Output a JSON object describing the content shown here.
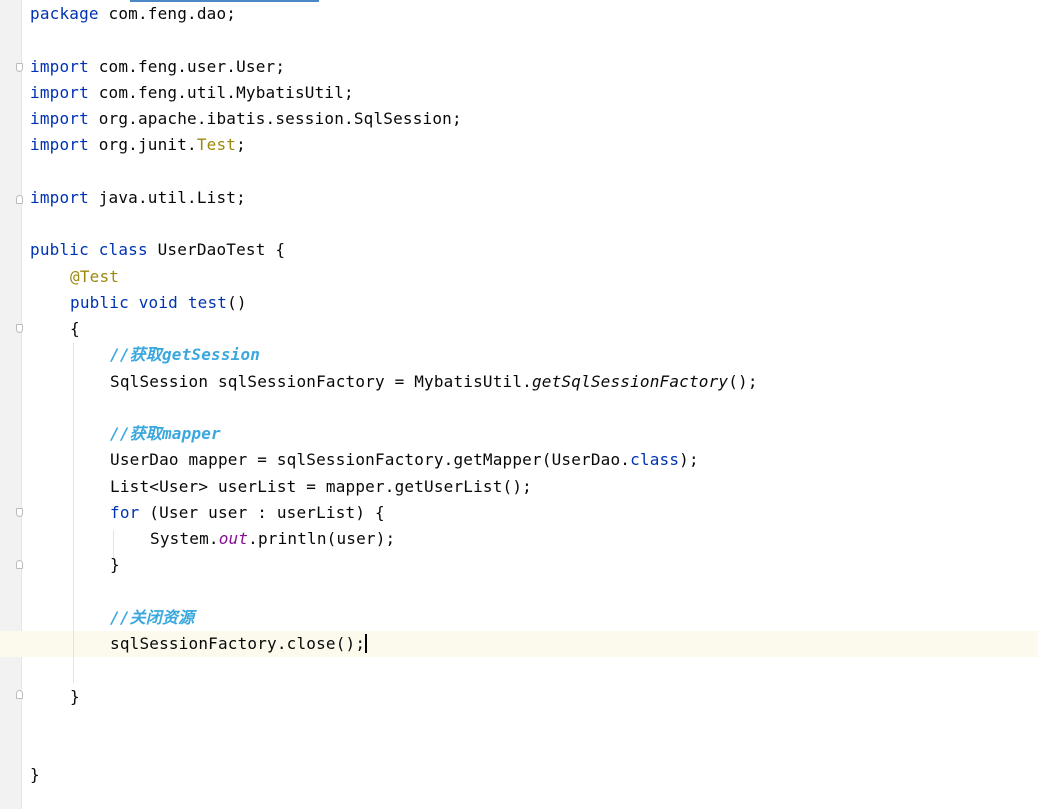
{
  "editor": {
    "code": {
      "package_kw": "package",
      "package_name": " com.feng.dao;",
      "import_kw": "import",
      "import_1": " com.feng.user.User;",
      "import_2": " com.feng.util.MybatisUtil;",
      "import_3": " org.apache.ibatis.session.SqlSession;",
      "import_4_pre": " org.junit.",
      "import_4_test": "Test",
      "import_4_post": ";",
      "import_5": " java.util.List;",
      "public_kw": "public",
      "class_kw": "class",
      "class_name": " UserDaoTest {",
      "annotation": "@Test",
      "void_kw": "void",
      "method_name": "test",
      "method_parens": "()",
      "open_brace": "{",
      "comment_1": "//获取getSession",
      "line_session_pre": "SqlSession sqlSessionFactory = MybatisUtil.",
      "line_session_call": "getSqlSessionFactory",
      "line_session_post": "();",
      "comment_2": "//获取mapper",
      "line_mapper_pre": "UserDao mapper = sqlSessionFactory.getMapper(UserDao.",
      "line_mapper_class": "class",
      "line_mapper_post": ");",
      "line_list": "List<User> userList = mapper.getUserList();",
      "for_kw": "for",
      "for_rest": " (User user : userList) {",
      "print_pre": "System.",
      "print_out": "out",
      "print_post": ".println(user);",
      "close_brace": "}",
      "comment_3": "//关闭资源",
      "line_close": "sqlSessionFactory.close();"
    }
  },
  "colors": {
    "keyword": "#0033b3",
    "annotation": "#9e880d",
    "comment": "#3aa8de",
    "static_field": "#871094",
    "caret_line": "#fcfaed",
    "gutter": "#f2f2f2"
  }
}
